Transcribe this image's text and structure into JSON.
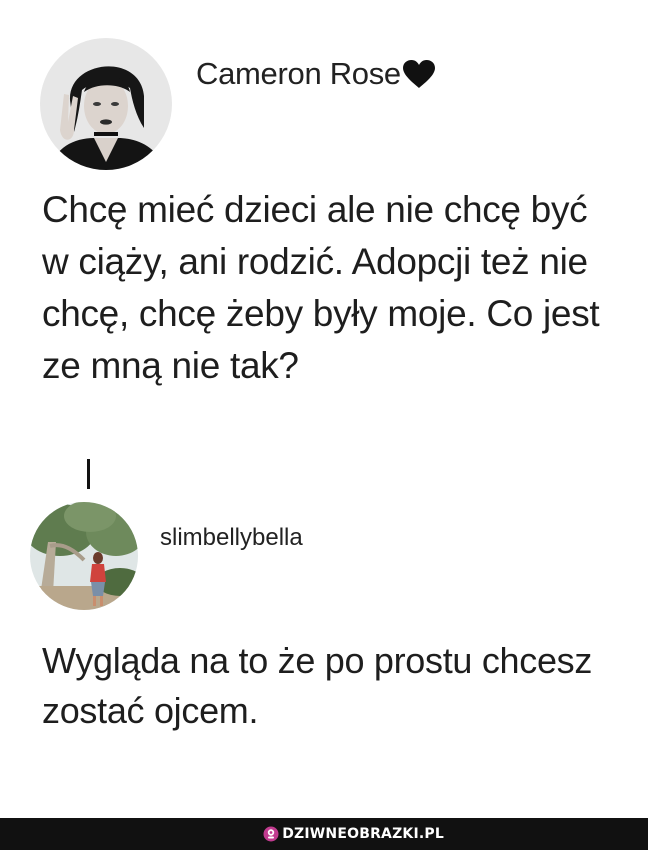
{
  "post": {
    "author": "Cameron Rose",
    "author_emoji": "black-heart-icon",
    "text": "Chcę mieć dzieci ale nie chcę być w ciąży, ani rodzić. Adopcji też nie chcę, chcę żeby były moje. Co jest ze mną nie tak?"
  },
  "reply": {
    "author": "slimbellybella",
    "text": "Wygląda na to że po prostu chcesz zostać ojcem."
  },
  "footer": {
    "watermark": "DZIWNEOBRAZKI.PL"
  },
  "colors": {
    "background": "#ffffff",
    "text": "#1e1e1e",
    "footer": "#111111",
    "watermark_icon": "#c13b8f"
  }
}
